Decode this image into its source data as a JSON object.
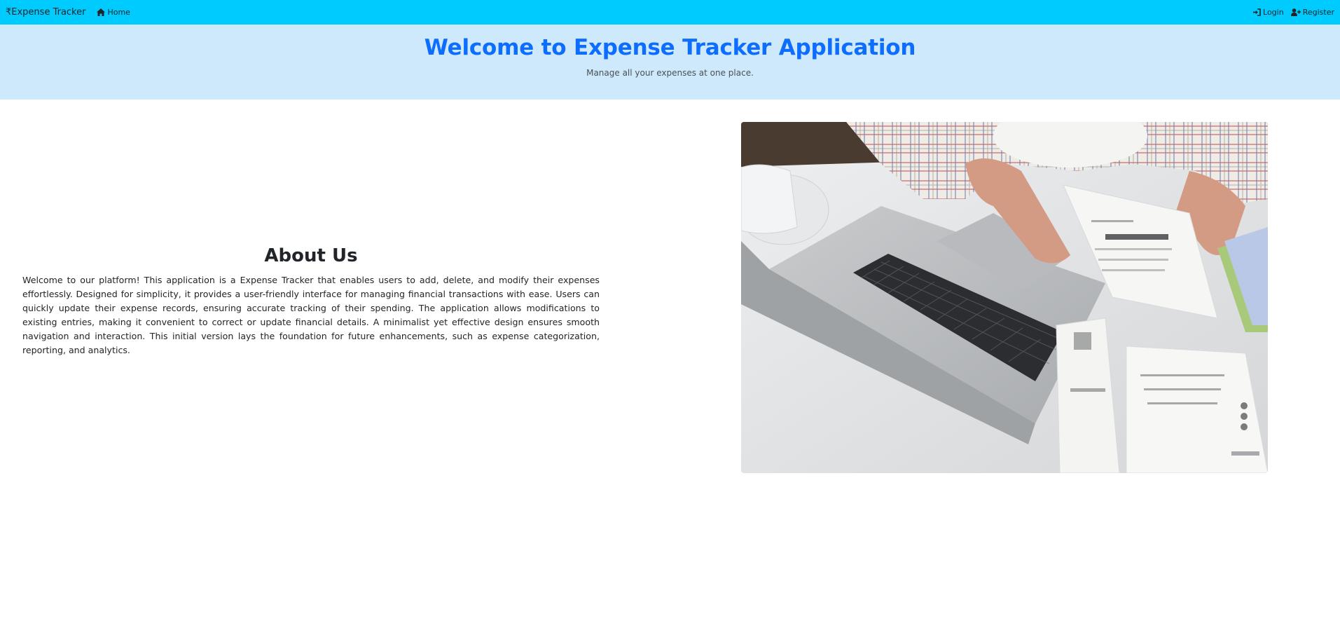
{
  "navbar": {
    "brand": "₹Expense Tracker",
    "home_label": "Home",
    "login_label": "Login",
    "register_label": "Register"
  },
  "hero": {
    "title": "Welcome to Expense Tracker Application",
    "subtitle": "Manage all your expenses at one place."
  },
  "about": {
    "heading": "About Us",
    "body": "Welcome to our platform! This application is a Expense Tracker that enables users to add, delete, and modify their expenses effortlessly. Designed for simplicity, it provides a user-friendly interface for managing financial transactions with ease. Users can quickly update their expense records, ensuring accurate tracking of their spending. The application allows modifications to existing entries, making it convenient to correct or update financial details. A minimalist yet effective design ensures smooth navigation and interaction. This initial version lays the foundation for future enhancements, such as expense categorization, reporting, and analytics."
  },
  "colors": {
    "navbar_bg": "#00cbff",
    "hero_bg": "#cfe9fc",
    "title_blue": "#0d6efd"
  },
  "icons": {
    "home": "home-icon",
    "login": "login-icon",
    "register": "user-plus-icon"
  }
}
